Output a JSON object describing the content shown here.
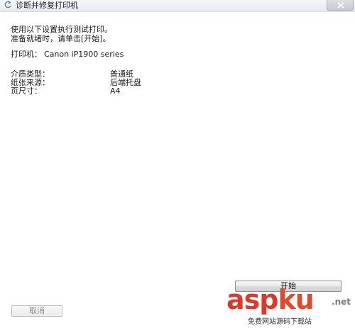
{
  "window": {
    "title": "诊断并修复打印机"
  },
  "content": {
    "instruction_line1": "使用以下设置执行测试打印。",
    "instruction_line2": "准备就绪时，请单击[开始]。",
    "printer_label": "打印机：",
    "printer_name": "Canon iP1900 series",
    "settings": [
      {
        "label": "介质类型：",
        "value": "普通纸"
      },
      {
        "label": "纸张来源：",
        "value": "后端托盘"
      },
      {
        "label": "页尺寸：",
        "value": "A4"
      }
    ]
  },
  "buttons": {
    "start": "开始",
    "cancel": "取消"
  },
  "watermark": {
    "brand_asp": "asp",
    "brand_ku": "ku",
    "brand_net": ".net",
    "tagline": "免费网站源码下载站"
  },
  "colors": {
    "watermark_red": "#d93a2b",
    "titlebar": "#e6eaf0"
  },
  "icons": {
    "back": "back-arrow-icon",
    "close": "close-icon"
  }
}
